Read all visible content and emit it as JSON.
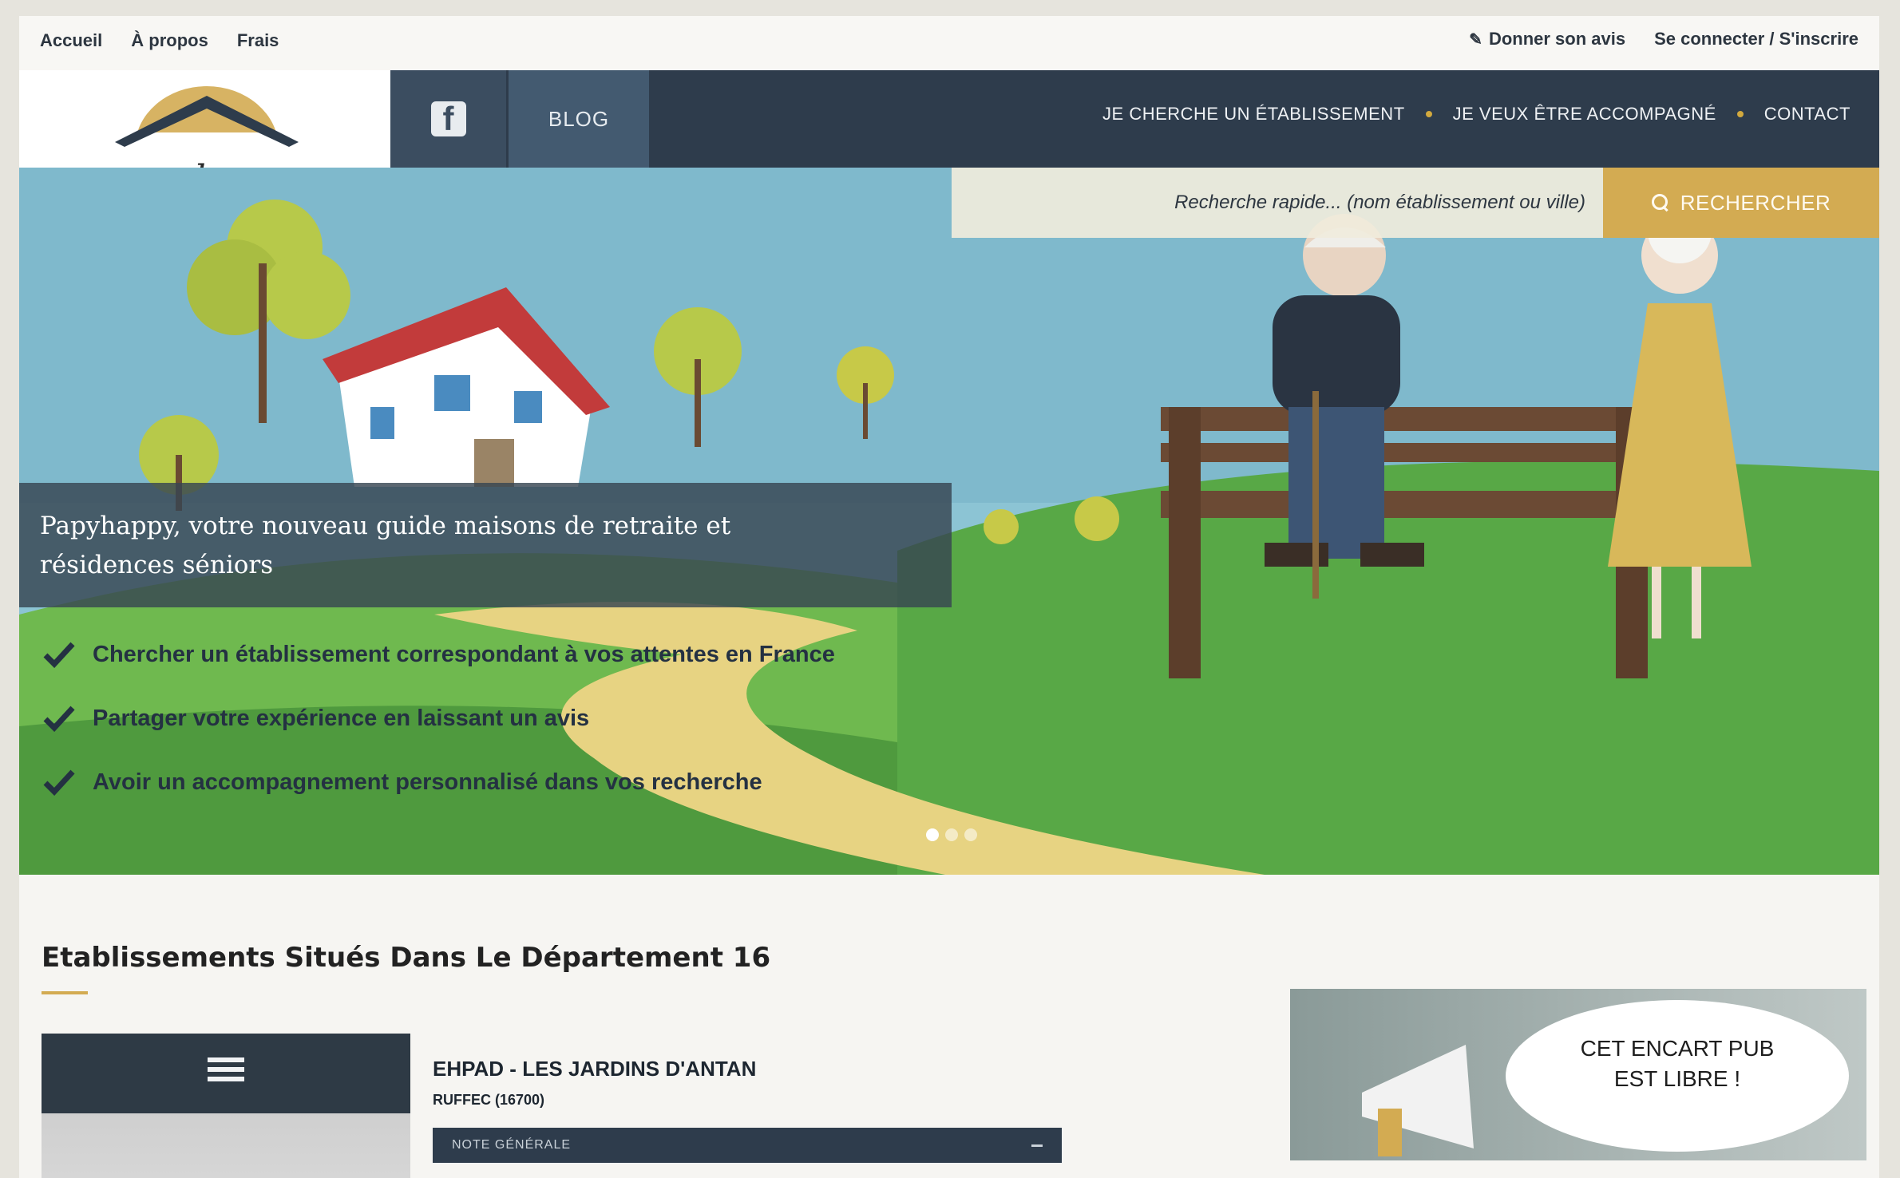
{
  "topbar": {
    "left_links": [
      "Accueil",
      "À propos",
      "Frais"
    ],
    "give_review": "Donner son avis",
    "login": "Se connecter / S'inscrire"
  },
  "logo": {
    "text": "papyhappy"
  },
  "nav": {
    "facebook_icon": "f",
    "blog": "BLOG",
    "items": [
      "JE CHERCHE UN ÉTABLISSEMENT",
      "JE VEUX ÊTRE ACCOMPAGNÉ",
      "CONTACT"
    ]
  },
  "search": {
    "placeholder": "Recherche rapide... (nom établissement ou ville)",
    "button": "RECHERCHER"
  },
  "hero": {
    "banner_line1": "Papyhappy, votre nouveau guide maisons de retraite et",
    "banner_line2": "résidences séniors",
    "checklist": [
      "Chercher un établissement correspondant à vos attentes en France",
      "Partager votre expérience en laissant un avis",
      "Avoir un accompagnement personnalisé dans vos recherche"
    ],
    "slides": 3,
    "active_slide": 1
  },
  "section": {
    "title": "Etablissements Situés Dans Le Département 16"
  },
  "listing": {
    "name": "EHPAD - LES JARDINS D'ANTAN",
    "city": "RUFFEC (16700)",
    "rating_label": "NOTE GÉNÉRALE"
  },
  "ad": {
    "line1": "CET ENCART PUB",
    "line2": "EST LIBRE !"
  },
  "colors": {
    "navy": "#2e3c4c",
    "gold": "#d3ab52",
    "grass": "#5aa845",
    "sky": "#8cc4d4"
  }
}
